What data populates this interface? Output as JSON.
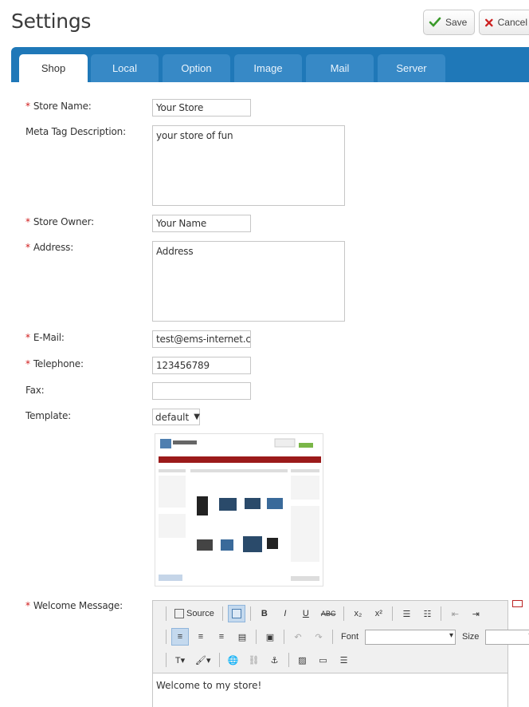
{
  "header": {
    "title": "Settings",
    "save_label": "Save",
    "cancel_label": "Cancel"
  },
  "tabs": [
    {
      "label": "Shop",
      "active": true
    },
    {
      "label": "Local",
      "active": false
    },
    {
      "label": "Option",
      "active": false
    },
    {
      "label": "Image",
      "active": false
    },
    {
      "label": "Mail",
      "active": false
    },
    {
      "label": "Server",
      "active": false
    }
  ],
  "form": {
    "store_name": {
      "label": "Store Name:",
      "value": "Your Store",
      "required": true
    },
    "meta_description": {
      "label": "Meta Tag Description:",
      "value": "your store of fun",
      "required": false
    },
    "store_owner": {
      "label": "Store Owner:",
      "value": "Your Name",
      "required": true
    },
    "address": {
      "label": "Address:",
      "value": "Address",
      "required": true
    },
    "email": {
      "label": "E-Mail:",
      "value": "test@ems-internet.co.",
      "required": true
    },
    "telephone": {
      "label": "Telephone:",
      "value": "123456789",
      "required": true
    },
    "fax": {
      "label": "Fax:",
      "value": "",
      "required": false
    },
    "template": {
      "label": "Template:",
      "value": "default"
    },
    "welcome": {
      "label": "Welcome Message:",
      "value": "Welcome to my store!",
      "required": true
    }
  },
  "required_mark": "*",
  "editor": {
    "source_label": "Source",
    "font_label": "Font",
    "size_label": "Size"
  },
  "colors": {
    "tab_bar": "#1f78b8",
    "tab": "#3789c6",
    "required": "#d01a1a",
    "save_check": "#3a9a2a",
    "cancel_x": "#cc2020"
  }
}
